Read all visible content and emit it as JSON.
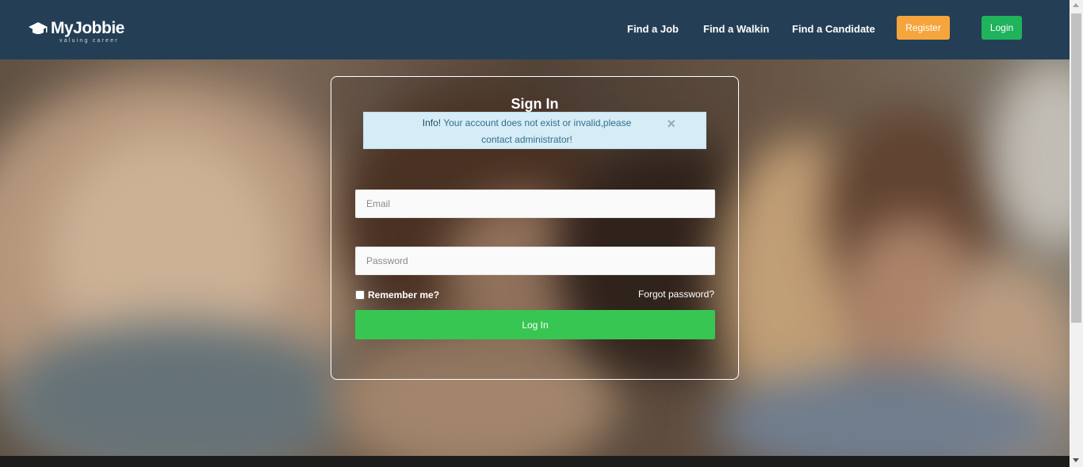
{
  "header": {
    "brand": "MyJobbie",
    "tagline": "valuing career",
    "nav": [
      {
        "label": "Find a Job"
      },
      {
        "label": "Find a Walkin"
      },
      {
        "label": "Find a Candidate"
      }
    ],
    "register_label": "Register",
    "login_label": "Login"
  },
  "signin": {
    "title": "Sign In",
    "alert": {
      "prefix": "Info!",
      "message": "Your account does not exist or invalid,please contact administrator!",
      "close_symbol": "×"
    },
    "email_placeholder": "Email",
    "password_placeholder": "Password",
    "remember_label": "Remember me?",
    "forgot_label": "Forgot password?",
    "submit_label": "Log In"
  },
  "colors": {
    "navbar": "#243f55",
    "register": "#f6a53d",
    "login": "#1fb35c",
    "submit": "#38c652",
    "alert_bg": "#d6ecf6"
  }
}
